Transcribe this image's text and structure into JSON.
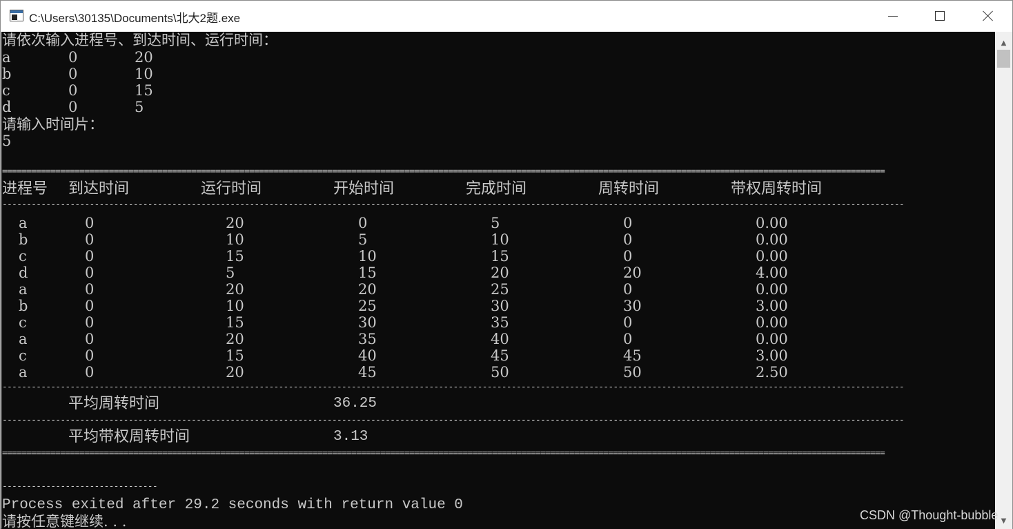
{
  "window": {
    "title": "C:\\Users\\30135\\Documents\\北大2题.exe"
  },
  "console": {
    "prompt_input": "请依次输入进程号、到达时间、运行时间：",
    "input_rows": [
      {
        "name": "a",
        "arrive": "0",
        "run": "20"
      },
      {
        "name": "b",
        "arrive": "0",
        "run": "10"
      },
      {
        "name": "c",
        "arrive": "0",
        "run": "15"
      },
      {
        "name": "d",
        "arrive": "0",
        "run": "5"
      }
    ],
    "prompt_slice": "请输入时间片：",
    "slice_value": "5",
    "double_rule": "======================================================================================================================================================================================",
    "single_rule": "------------------------------------------------------------------------------------------------------------------------------------------------------------------------------------------",
    "headers": [
      "进程号",
      "到达时间",
      "运行时间",
      "开始时间",
      "完成时间",
      "周转时间",
      "带权周转时间"
    ],
    "rows": [
      [
        "a",
        "0",
        "20",
        "0",
        "5",
        "0",
        "0.00"
      ],
      [
        "b",
        "0",
        "10",
        "5",
        "10",
        "0",
        "0.00"
      ],
      [
        "c",
        "0",
        "15",
        "10",
        "15",
        "0",
        "0.00"
      ],
      [
        "d",
        "0",
        "5",
        "15",
        "20",
        "20",
        "4.00"
      ],
      [
        "a",
        "0",
        "20",
        "20",
        "25",
        "0",
        "0.00"
      ],
      [
        "b",
        "0",
        "10",
        "25",
        "30",
        "30",
        "3.00"
      ],
      [
        "c",
        "0",
        "15",
        "30",
        "35",
        "0",
        "0.00"
      ],
      [
        "a",
        "0",
        "20",
        "35",
        "40",
        "0",
        "0.00"
      ],
      [
        "c",
        "0",
        "15",
        "40",
        "45",
        "45",
        "3.00"
      ],
      [
        "a",
        "0",
        "20",
        "45",
        "50",
        "50",
        "2.50"
      ]
    ],
    "avg_turnaround_label": "平均周转时间",
    "avg_turnaround_value": "36.25",
    "avg_weighted_label": "平均带权周转时间",
    "avg_weighted_value": "3.13",
    "short_rule": "--------------------------------",
    "exit_message": "Process exited after 29.2 seconds with return value 0",
    "continue_prompt": "请按任意键继续. . ."
  },
  "watermark": "CSDN @Thought-bubble"
}
